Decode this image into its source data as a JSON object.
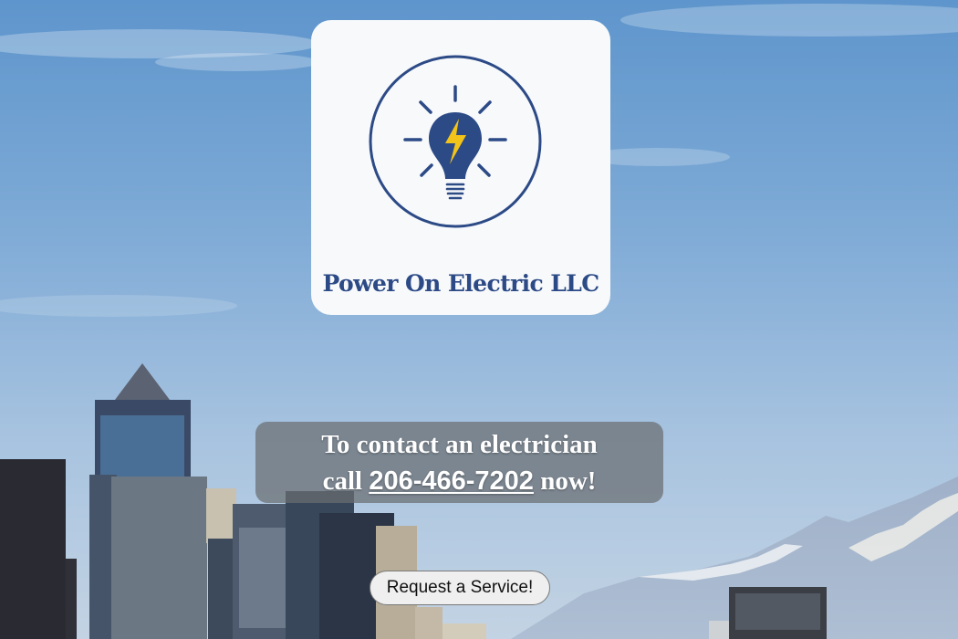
{
  "hero": {
    "background": "seattle-skyline-with-mountain-photo"
  },
  "logo": {
    "icon": "lightbulb-bolt-icon",
    "name": "Power On Electric LLC",
    "brand_color": "#2c4a86",
    "bolt_color": "#f2c318"
  },
  "contact": {
    "line1": "To contact an electrician",
    "call_prefix": "call",
    "phone": "206-466-7202",
    "call_suffix": "now!"
  },
  "cta": {
    "request_label": "Request a Service!"
  }
}
